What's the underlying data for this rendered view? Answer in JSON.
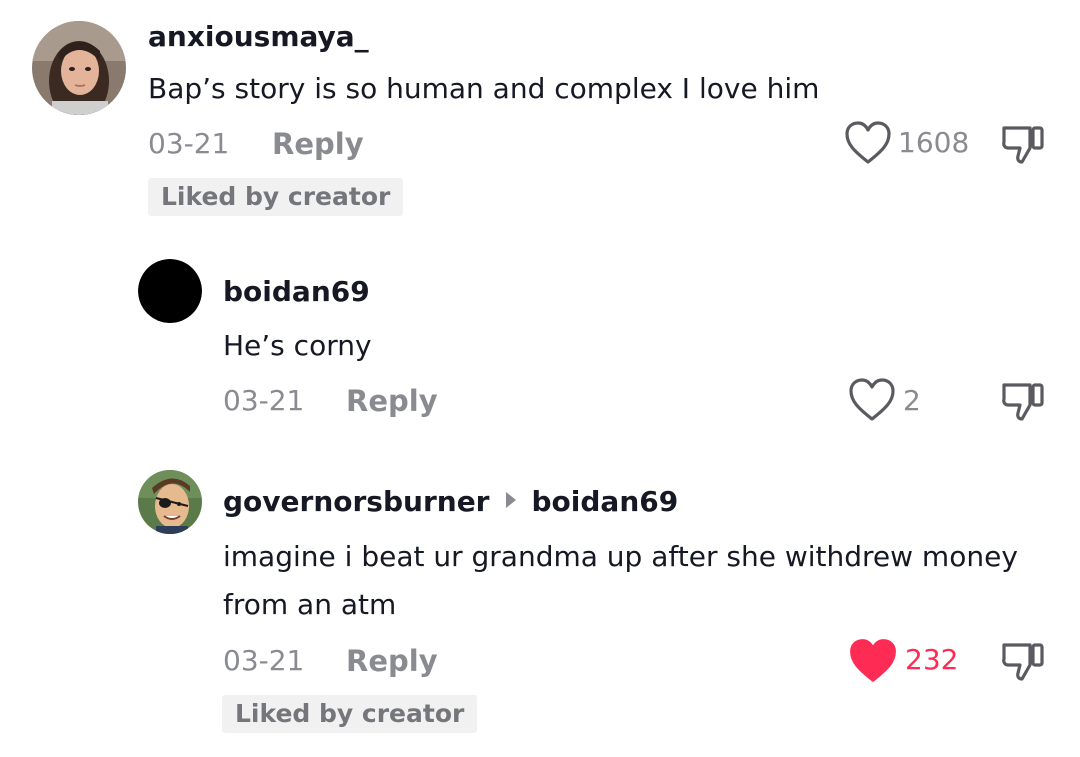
{
  "comments": [
    {
      "username": "anxiousmaya_",
      "text_lines": [
        "Bap’s story is so human and complex I love him"
      ],
      "date": "03-21",
      "reply_label": "Reply",
      "like_count": "1608",
      "liked": false,
      "badge": "Liked by creator",
      "avatar_icon": "photo-avatar"
    },
    {
      "username": "boidan69",
      "text_lines": [
        "He’s corny"
      ],
      "date": "03-21",
      "reply_label": "Reply",
      "like_count": "2",
      "liked": false,
      "avatar_icon": "black-circle-avatar"
    },
    {
      "username": "governorsburner",
      "reply_to": "boidan69",
      "text_lines": [
        "imagine i beat ur grandma up after she withdrew money",
        "from an atm"
      ],
      "date": "03-21",
      "reply_label": "Reply",
      "like_count": "232",
      "liked": true,
      "badge": "Liked by creator",
      "avatar_icon": "cartoon-avatar"
    }
  ],
  "colors": {
    "text": "#161823",
    "muted": "#8a8b91",
    "like_active": "#fe2c55",
    "badge_bg": "#f1f1f2"
  },
  "icons": {
    "like": "heart-icon",
    "dislike": "thumbs-down-icon",
    "reply_to": "triangle-right-icon"
  }
}
